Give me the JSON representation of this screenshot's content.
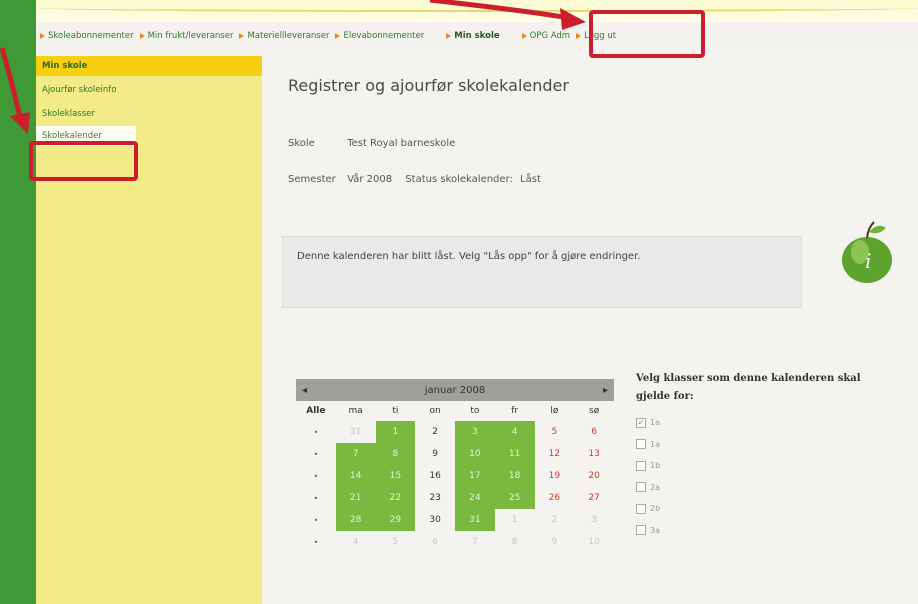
{
  "nav": {
    "items": [
      {
        "label": "Skoleabonnementer"
      },
      {
        "label": "Min frukt/leveranser"
      },
      {
        "label": "Materiellleveranser"
      },
      {
        "label": "Elevabonnementer"
      },
      {
        "label": "Min skole",
        "active": true
      },
      {
        "label": "OPG Adm"
      },
      {
        "label": "Logg ut"
      }
    ]
  },
  "sidebar": {
    "items": [
      {
        "label": "Min skole"
      },
      {
        "label": "Ajourfør skoleinfo"
      },
      {
        "label": "Skoleklasser"
      },
      {
        "label": "Skolekalender"
      }
    ]
  },
  "main": {
    "title": "Registrer og ajourfør skolekalender",
    "school_label": "Skole",
    "school_value": "Test Royal barneskole",
    "semester_label": "Semester",
    "semester_value": "Vår 2008",
    "status_label": "Status skolekalender:",
    "status_value": "Låst",
    "notice": "Denne kalenderen har blitt låst. Velg \"Lås opp\" for å gjøre endringer."
  },
  "calendar": {
    "prev": "◂",
    "next": "▸",
    "month": "januar 2008",
    "all_label": "Alle",
    "days": [
      "ma",
      "ti",
      "on",
      "to",
      "fr",
      "lø",
      "sø"
    ],
    "week_marker": "•",
    "weeks": [
      [
        "31",
        "1",
        "2",
        "3",
        "4",
        "5",
        "6"
      ],
      [
        "7",
        "8",
        "9",
        "10",
        "11",
        "12",
        "13"
      ],
      [
        "14",
        "15",
        "16",
        "17",
        "18",
        "19",
        "20"
      ],
      [
        "21",
        "22",
        "23",
        "24",
        "25",
        "26",
        "27"
      ],
      [
        "28",
        "29",
        "30",
        "31",
        "1",
        "2",
        "3"
      ],
      [
        "4",
        "5",
        "6",
        "7",
        "8",
        "9",
        "10"
      ]
    ]
  },
  "classes": {
    "heading_line1": "Velg klasser som denne kalenderen skal",
    "heading_line2": "gjelde for:",
    "items": [
      {
        "label": "1a",
        "checked": true
      },
      {
        "label": "1a"
      },
      {
        "label": "1b"
      },
      {
        "label": "2a"
      },
      {
        "label": "2b"
      },
      {
        "label": "3a"
      }
    ]
  },
  "colors": {
    "green_bar": "#3f9a36",
    "sidebar_bg": "#f3ea88",
    "sidebar_active": "#f5cf10",
    "selected_day": "#7ab93f",
    "highlight_red": "#cc1f2e",
    "weekend_red": "#d03a2a"
  }
}
